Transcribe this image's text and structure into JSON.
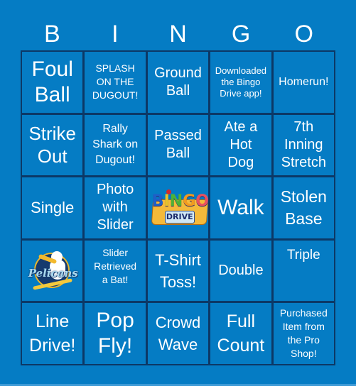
{
  "header": {
    "letters": [
      "B",
      "I",
      "N",
      "G",
      "O"
    ]
  },
  "colors": {
    "background": "#057cc4",
    "grid_lines": "#0c3866",
    "text": "#ffffff"
  },
  "cells": [
    {
      "row": 1,
      "col": 1,
      "lines": [
        "Foul",
        "Ball"
      ]
    },
    {
      "row": 1,
      "col": 2,
      "lines": [
        "SPLASH",
        "ON THE",
        "DUGOUT!"
      ]
    },
    {
      "row": 1,
      "col": 3,
      "lines": [
        "Ground",
        "Ball"
      ]
    },
    {
      "row": 1,
      "col": 4,
      "lines": [
        "Downloaded",
        "the Bingo",
        "Drive app!"
      ]
    },
    {
      "row": 1,
      "col": 5,
      "lines": [
        "Homerun!"
      ]
    },
    {
      "row": 2,
      "col": 1,
      "lines": [
        "Strike",
        "Out"
      ]
    },
    {
      "row": 2,
      "col": 2,
      "lines": [
        "Rally",
        "Shark on",
        "Dugout!"
      ]
    },
    {
      "row": 2,
      "col": 3,
      "lines": [
        "Passed",
        "Ball"
      ]
    },
    {
      "row": 2,
      "col": 4,
      "lines": [
        "Ate a",
        "Hot",
        "Dog"
      ]
    },
    {
      "row": 2,
      "col": 5,
      "lines": [
        "7th",
        "Inning",
        "Stretch"
      ]
    },
    {
      "row": 3,
      "col": 1,
      "lines": [
        "Single"
      ]
    },
    {
      "row": 3,
      "col": 2,
      "lines": [
        "Photo",
        "with",
        "Slider"
      ]
    },
    {
      "row": 3,
      "col": 3,
      "image": "bingo-drive-logo",
      "logo_text": {
        "letters": [
          "B",
          "I",
          "N",
          "G",
          "O"
        ],
        "sub": "DRIVE"
      }
    },
    {
      "row": 3,
      "col": 4,
      "lines": [
        "Walk"
      ]
    },
    {
      "row": 3,
      "col": 5,
      "lines": [
        "Stolen",
        "Base"
      ]
    },
    {
      "row": 4,
      "col": 1,
      "image": "pelicans-logo",
      "logo_text": "Pelicans"
    },
    {
      "row": 4,
      "col": 2,
      "lines": [
        "Slider",
        "Retrieved",
        "a Bat!"
      ]
    },
    {
      "row": 4,
      "col": 3,
      "lines": [
        "T-Shirt",
        "Toss!"
      ]
    },
    {
      "row": 4,
      "col": 4,
      "lines": [
        "Double"
      ]
    },
    {
      "row": 4,
      "col": 5,
      "lines": [
        "Triple"
      ]
    },
    {
      "row": 5,
      "col": 1,
      "lines": [
        "Line",
        "Drive!"
      ]
    },
    {
      "row": 5,
      "col": 2,
      "lines": [
        "Pop",
        "Fly!"
      ]
    },
    {
      "row": 5,
      "col": 3,
      "lines": [
        "Crowd",
        "Wave"
      ]
    },
    {
      "row": 5,
      "col": 4,
      "lines": [
        "Full",
        "Count"
      ]
    },
    {
      "row": 5,
      "col": 5,
      "lines": [
        "Purchased",
        "Item from",
        "the Pro",
        "Shop!"
      ]
    }
  ]
}
